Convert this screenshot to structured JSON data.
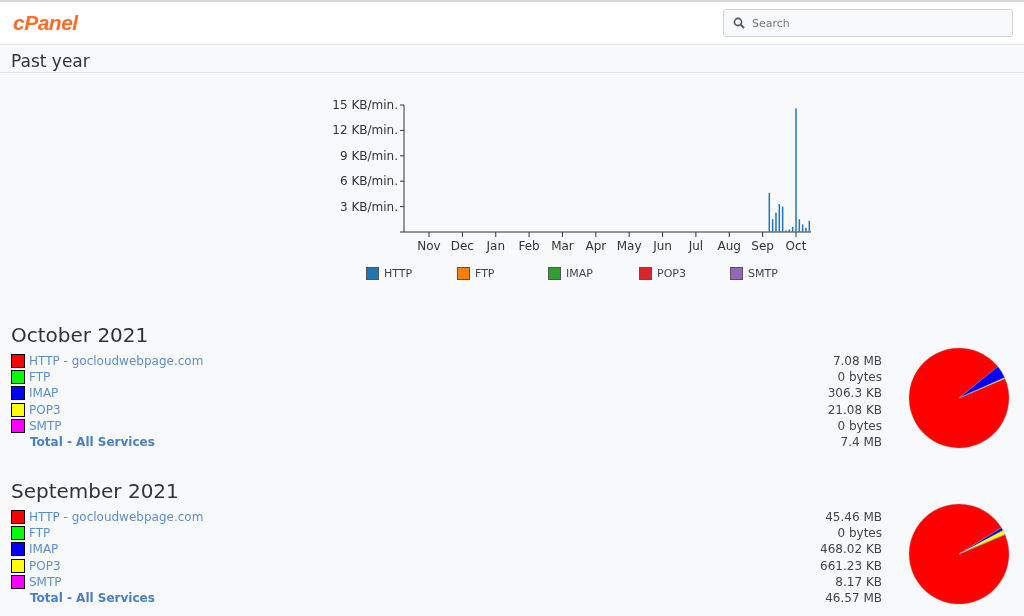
{
  "header": {
    "logo": "cPanel",
    "search": {
      "placeholder": "Search"
    }
  },
  "past_year": {
    "title": "Past year",
    "chart_data": {
      "type": "bar",
      "ylim": [
        0,
        15
      ],
      "categories": [
        null,
        null,
        null,
        null,
        null,
        null,
        null,
        "Nov",
        null,
        null,
        null,
        null,
        null,
        null,
        null,
        null,
        null,
        "Dec",
        null,
        null,
        null,
        null,
        null,
        null,
        null,
        null,
        null,
        "Jan",
        null,
        null,
        null,
        null,
        null,
        null,
        null,
        null,
        null,
        "Feb",
        null,
        null,
        null,
        null,
        null,
        null,
        null,
        null,
        null,
        "Mar",
        null,
        null,
        null,
        null,
        null,
        null,
        null,
        null,
        null,
        "Apr",
        null,
        null,
        null,
        null,
        null,
        null,
        null,
        null,
        null,
        "May",
        null,
        null,
        null,
        null,
        null,
        null,
        null,
        null,
        null,
        "Jun",
        null,
        null,
        null,
        null,
        null,
        null,
        null,
        null,
        null,
        "Jul",
        null,
        null,
        null,
        null,
        null,
        null,
        null,
        null,
        null,
        "Aug",
        null,
        null,
        null,
        null,
        null,
        null,
        null,
        null,
        null,
        "Sep",
        null,
        null,
        null,
        null,
        null,
        null,
        null,
        null,
        null,
        "Oct",
        null,
        null,
        null,
        null
      ],
      "yticks": [
        {
          "value": 3,
          "label": "3 KB/min."
        },
        {
          "value": 6,
          "label": "6 KB/min."
        },
        {
          "value": 9,
          "label": "9 KB/min."
        },
        {
          "value": 12,
          "label": "12 KB/min."
        },
        {
          "value": 15,
          "label": "15 KB/min."
        }
      ],
      "series": [
        {
          "color": "#1f77b4",
          "values": [
            0,
            0,
            0,
            0,
            0,
            0,
            0,
            0,
            0,
            0,
            0,
            0,
            0,
            0,
            0,
            0,
            0,
            0,
            0,
            0,
            0,
            0,
            0,
            0,
            0,
            0,
            0,
            0,
            0,
            0,
            0,
            0,
            0,
            0,
            0,
            0,
            0,
            0,
            0,
            0,
            0,
            0,
            0,
            0,
            0,
            0,
            0,
            0,
            0,
            0,
            0,
            0,
            0,
            0,
            0,
            0,
            0,
            0,
            0,
            0,
            0,
            0,
            0,
            0,
            0,
            0,
            0,
            0,
            0,
            0,
            0,
            0,
            0,
            0,
            0,
            0,
            0,
            0,
            0,
            0,
            0,
            0,
            0,
            0,
            0,
            0,
            0,
            0,
            0,
            0,
            0,
            0,
            0,
            0,
            0,
            0,
            0,
            0,
            0,
            0,
            0,
            0,
            0,
            0,
            0,
            0,
            0,
            0,
            0,
            4.6,
            1.5,
            2.3,
            3.3,
            3.0,
            0.2,
            0.3,
            0.6,
            14.6,
            1.5,
            0.9,
            0.5,
            1.3
          ]
        }
      ]
    },
    "legend": [
      {
        "name": "HTTP",
        "color": "#1f77b4"
      },
      {
        "name": "FTP",
        "color": "#ff7f0e"
      },
      {
        "name": "IMAP",
        "color": "#2ca02c"
      },
      {
        "name": "POP3",
        "color": "#d62728"
      },
      {
        "name": "SMTP",
        "color": "#9467bd"
      }
    ]
  },
  "months": [
    {
      "title": "October 2021",
      "rows": [
        {
          "label": "HTTP - gocloudwebpage.com",
          "value": "7.08 MB",
          "color": "#ff0000"
        },
        {
          "label": "FTP",
          "value": "0 bytes",
          "color": "#00ff00"
        },
        {
          "label": "IMAP",
          "value": "306.3 KB",
          "color": "#0000ff"
        },
        {
          "label": "POP3",
          "value": "21.08 KB",
          "color": "#ffff00"
        },
        {
          "label": "SMTP",
          "value": "0 bytes",
          "color": "#ff00ff"
        }
      ],
      "total": {
        "label": "Total - All Services",
        "value": "7.4 MB"
      },
      "chart_data": {
        "type": "pie",
        "values": [
          95.58,
          0,
          4.14,
          0.28,
          0
        ]
      }
    },
    {
      "title": "September 2021",
      "rows": [
        {
          "label": "HTTP - gocloudwebpage.com",
          "value": "45.46 MB",
          "color": "#ff0000"
        },
        {
          "label": "FTP",
          "value": "0 bytes",
          "color": "#00ff00"
        },
        {
          "label": "IMAP",
          "value": "468.02 KB",
          "color": "#0000ff"
        },
        {
          "label": "POP3",
          "value": "661.23 KB",
          "color": "#ffff00"
        },
        {
          "label": "SMTP",
          "value": "8.17 KB",
          "color": "#ff00ff"
        }
      ],
      "total": {
        "label": "Total - All Services",
        "value": "46.57 MB"
      },
      "chart_data": {
        "type": "pie",
        "values": [
          97.56,
          0,
          1.0,
          1.42,
          0.02
        ]
      }
    }
  ]
}
